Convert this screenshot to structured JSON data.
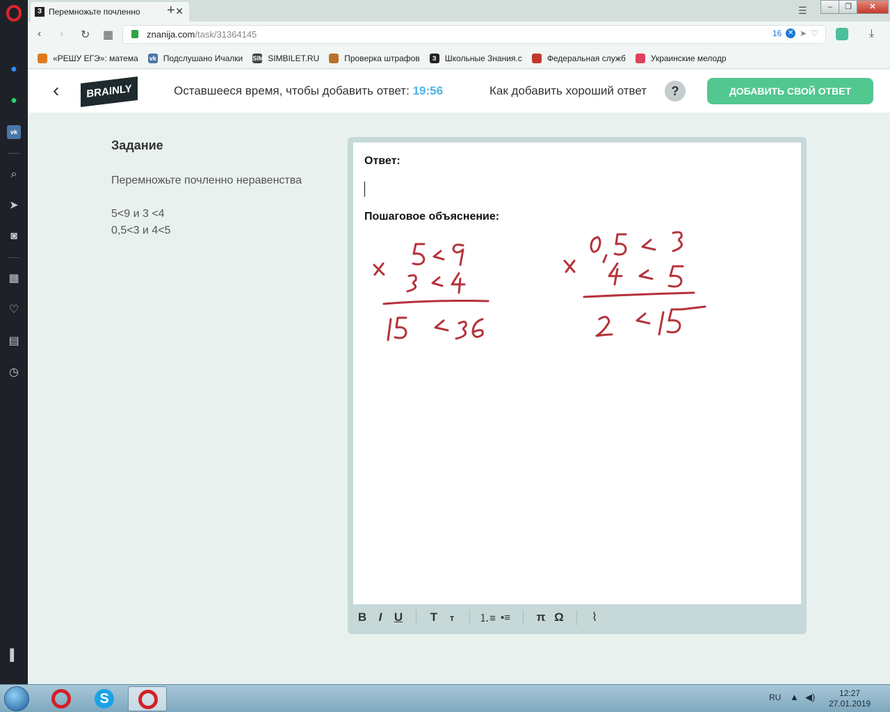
{
  "browser": {
    "tab": {
      "favicon": "З",
      "title": "Перемножьте почленно"
    },
    "url": {
      "host": "znanija.com",
      "path": "/task/31364145"
    },
    "adblock_count": "16",
    "bookmarks": [
      {
        "label": "«РЕШУ ЕГЭ»: матема",
        "color": "#e07a1c",
        "glyph": ""
      },
      {
        "label": "Подслушано Ичалки",
        "color": "#4a76a8",
        "glyph": "vk"
      },
      {
        "label": "SIMBILET.RU",
        "color": "#444444",
        "glyph": "SIM"
      },
      {
        "label": "Проверка штрафов",
        "color": "#b8732a",
        "glyph": ""
      },
      {
        "label": "Школьные Знания.c",
        "color": "#222222",
        "glyph": "З"
      },
      {
        "label": "Федеральная служб",
        "color": "#c0392b",
        "glyph": ""
      },
      {
        "label": "Украинские мелодр",
        "color": "#e0405a",
        "glyph": ""
      }
    ]
  },
  "header": {
    "logo_text": "BRAINLY",
    "time_label": "Оставшееся время, чтобы добавить ответ:",
    "time_value": "19:56",
    "howto_label": "Как добавить хороший ответ",
    "help_label": "?",
    "add_answer_label": "ДОБАВИТЬ СВОЙ ОТВЕТ"
  },
  "task": {
    "title": "Задание",
    "line1": "Перемножьте почленно неравенства",
    "line2": "5<9 и 3 <4",
    "line3": "0,5<3 и 4<5"
  },
  "editor": {
    "answer_label": "Ответ:",
    "explanation_label": "Пошаговое объяснение:",
    "toolbar": [
      "bold-icon",
      "italic-icon",
      "underline-icon",
      "text-large-icon",
      "text-small-icon",
      "ordered-list-icon",
      "bullet-list-icon",
      "pi-icon",
      "omega-icon",
      "attachment-icon"
    ],
    "toolbar_glyphs": {
      "bold": "B",
      "italic": "I",
      "underline": "U",
      "large": "T",
      "small": "т",
      "pi": "π",
      "omega": "Ω"
    }
  },
  "taskbar": {
    "lang": "RU",
    "time": "12:27",
    "date": "27.01.2019"
  }
}
